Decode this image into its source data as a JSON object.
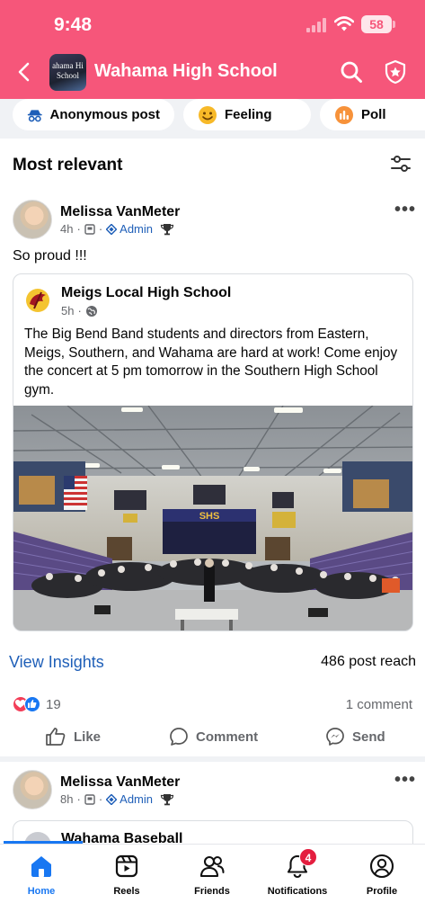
{
  "status_bar": {
    "time": "9:48",
    "battery": "58"
  },
  "header": {
    "title": "Wahama High School",
    "thumb_text_line1": "ahama Hi",
    "thumb_text_line2": "School",
    "icons": [
      "back-arrow-icon",
      "search-icon",
      "shield-star-icon"
    ]
  },
  "composer": {
    "chips": [
      {
        "label": "Anonymous post",
        "icon": "incognito-icon"
      },
      {
        "label": "Feeling",
        "icon": "smile-emoji-icon"
      },
      {
        "label": "Poll",
        "icon": "poll-icon"
      }
    ]
  },
  "feed": {
    "sort_label": "Most relevant"
  },
  "post1": {
    "author": "Melissa VanMeter",
    "time": "4h",
    "role": "Admin",
    "text": "So proud !!!",
    "shared": {
      "source": "Meigs Local High School",
      "time": "5h",
      "body": "The Big Bend Band students and directors from Eastern, Meigs, Southern, and Wahama are hard at work! Come enjoy the concert at 5 pm tomorrow in the Southern High School gym.",
      "photo_sign": "SHS"
    },
    "insights_label": "View Insights",
    "reach": "486 post reach",
    "reaction_count": "19",
    "comment_count": "1 comment",
    "actions": {
      "like": "Like",
      "comment": "Comment",
      "send": "Send"
    }
  },
  "post2": {
    "author": "Melissa VanMeter",
    "time": "8h",
    "role": "Admin",
    "shared_source": "Wahama Baseball"
  },
  "tabbar": {
    "tabs": [
      {
        "label": "Home"
      },
      {
        "label": "Reels"
      },
      {
        "label": "Friends"
      },
      {
        "label": "Notifications"
      },
      {
        "label": "Profile"
      }
    ],
    "notification_badge": "4"
  },
  "colors": {
    "brand": "#f6567a",
    "link": "#1f5fb8",
    "active_tab": "#1877f2",
    "badge": "#e41e3f"
  }
}
